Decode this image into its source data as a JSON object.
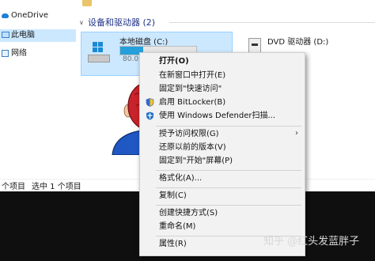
{
  "sidebar": {
    "items": [
      {
        "label": "OneDrive",
        "icon": "cloud-icon"
      },
      {
        "label": "此电脑",
        "icon": "computer-icon"
      },
      {
        "label": "网络",
        "icon": "network-icon"
      }
    ]
  },
  "content": {
    "group_header": "设备和驱动器 (2)",
    "drive_c": {
      "name": "本地磁盘 (C:)",
      "free_text": "80.0",
      "usage_fraction": 0.3
    },
    "dvd": {
      "name": "DVD 驱动器 (D:)"
    }
  },
  "statusbar": {
    "count_text": "个项目",
    "selected_text": "选中 1 个项目"
  },
  "context_menu": {
    "open": "打开(O)",
    "open_new_window": "在新窗口中打开(E)",
    "pin_quick_access": "固定到\"快速访问\"",
    "bitlocker": "启用 BitLocker(B)",
    "defender": "使用 Windows Defender扫描...",
    "grant_access": "授予访问权限(G)",
    "restore_versions": "还原以前的版本(V)",
    "pin_start": "固定到\"开始\"屏幕(P)",
    "format": "格式化(A)...",
    "copy": "复制(C)",
    "create_shortcut": "创建快捷方式(S)",
    "rename": "重命名(M)",
    "properties": "属性(R)"
  },
  "watermark": "知乎 @红头发蓝胖子",
  "colors": {
    "selection": "#cce8ff",
    "accent": "#26a0da",
    "menu_bg": "#f2f2f2",
    "taskbar": "#0f0f0f"
  }
}
